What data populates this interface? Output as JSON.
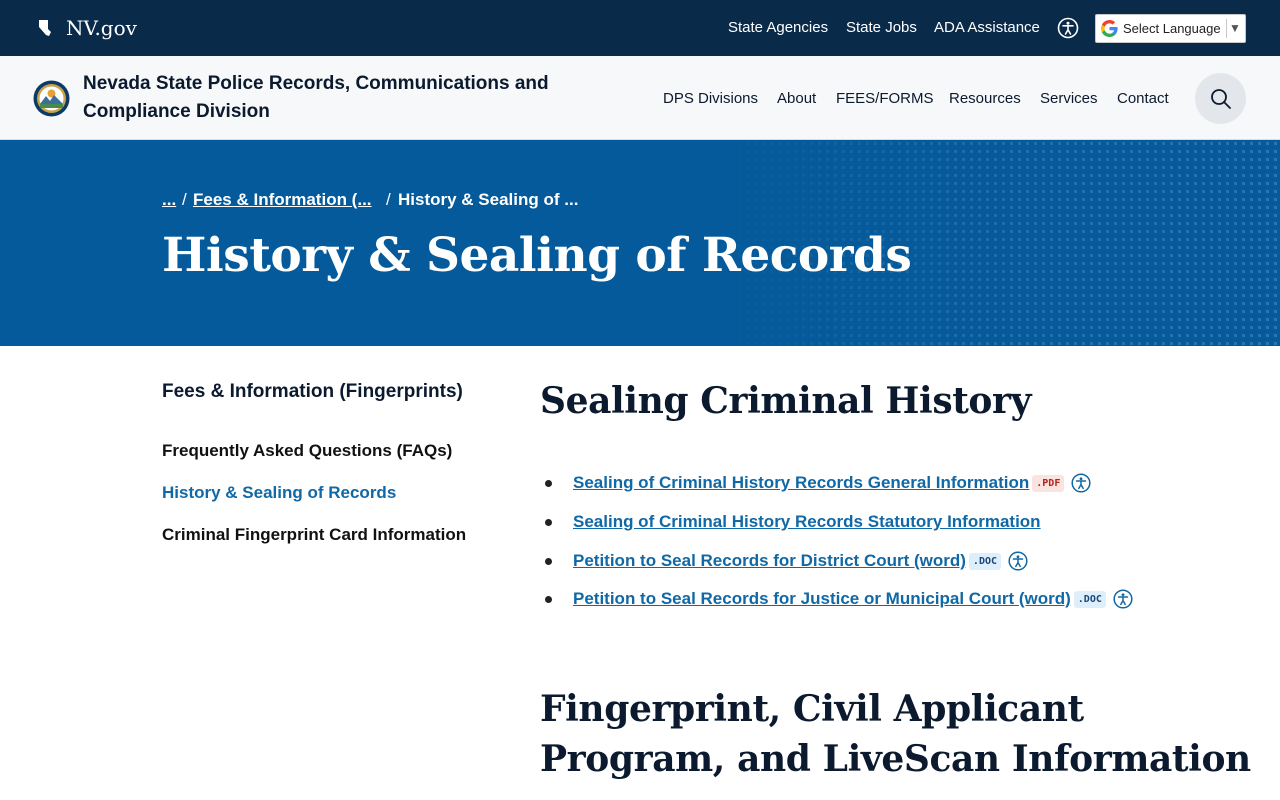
{
  "utility_bar": {
    "home_label": "NV.gov",
    "links": [
      "State Agencies",
      "State Jobs",
      "ADA Assistance"
    ],
    "language_label": "Select Language",
    "language_arrow": "▼"
  },
  "header": {
    "site_title": "Nevada State Police Records, Communications and Compliance Division",
    "nav": [
      "DPS Divisions",
      "About",
      "FEES/FORMS",
      "Resources",
      "Services",
      "Contact"
    ]
  },
  "breadcrumb": {
    "ellipsis": "...",
    "parent": "Fees & Information (...",
    "current": "History & Sealing of ...",
    "separator": "/"
  },
  "page_title": "History & Sealing of Records",
  "side_nav": {
    "title": "Fees & Information (Fingerprints)",
    "items": [
      "Frequently Asked Questions (FAQs)",
      "History & Sealing of Records",
      "Criminal Fingerprint Card Information"
    ]
  },
  "main": {
    "section1_title": "Sealing Criminal History",
    "documents": [
      {
        "label": "Sealing of Criminal History Records General Information",
        "badge": ".PDF"
      },
      {
        "label": "Sealing of Criminal History Records Statutory Information",
        "badge": ""
      },
      {
        "label": "Petition to Seal Records for District Court (word)",
        "badge": ".DOC"
      },
      {
        "label": "Petition to Seal Records for Justice or Municipal Court (word)",
        "badge": ".DOC"
      }
    ],
    "section2_title_line1": "Fingerprint, Civil Applicant",
    "section2_title_line2": "Program, and LiveScan Information"
  },
  "colors": {
    "top_bar": "#0a2a4a",
    "hero": "#045a9b",
    "link": "#1068a6"
  },
  "icons": {
    "state_logo": "nevada-state-outline-icon",
    "accessibility": "accessibility-person-icon",
    "google": "google-g-icon",
    "search": "search-icon",
    "seal": "nevada-seal-icon"
  }
}
